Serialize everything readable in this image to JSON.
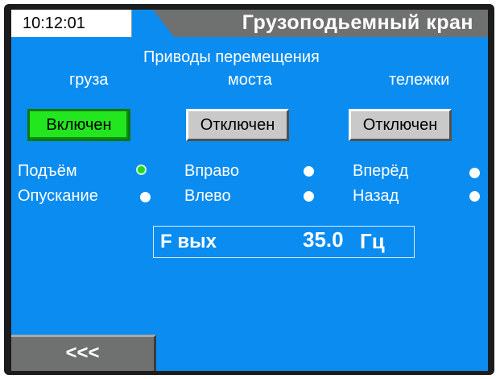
{
  "header": {
    "time": "10:12:01",
    "title": "Грузоподьемный кран"
  },
  "drives": {
    "section_title": "Приводы перемещения",
    "cargo": {
      "title": "груза",
      "button": "Включен",
      "state": "on",
      "indicators": [
        {
          "label": "Подъём",
          "color": "green"
        },
        {
          "label": "Опускание",
          "color": "white"
        }
      ]
    },
    "bridge": {
      "title": "моста",
      "button": "Отключен",
      "state": "off",
      "indicators": [
        {
          "label": "Вправо",
          "color": "white"
        },
        {
          "label": "Влево",
          "color": "white"
        }
      ]
    },
    "trolley": {
      "title": "тележки",
      "button": "Отключен",
      "state": "off",
      "indicators": [
        {
          "label": "Вперёд",
          "color": "white"
        },
        {
          "label": "Назад",
          "color": "white"
        }
      ]
    }
  },
  "frequency": {
    "label": "F вых",
    "value": "35.0",
    "unit": "Гц"
  },
  "nav": {
    "back_label": "<<<"
  },
  "colors": {
    "screen_bg": "#0a8cf0",
    "header_bar": "#6f7070",
    "button_on": "#22e61e",
    "button_off": "#c9c9c9",
    "indicator_active": "#27d427",
    "indicator_idle": "#ffffff"
  }
}
